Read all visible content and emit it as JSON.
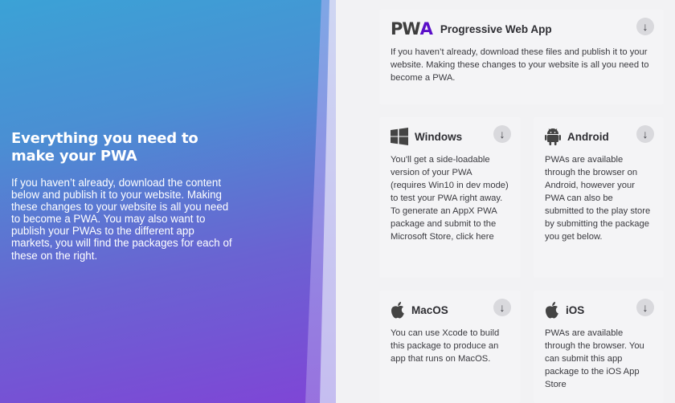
{
  "left": {
    "heading": "Everything you need to make your PWA",
    "description": "If you haven’t already, download the content below and publish it to your website. Making these changes to your website is all you need to become a PWA. You may also want to publish your PWAs to the different app markets, you will find the packages for each of these on the right."
  },
  "cards": {
    "pwa": {
      "logo": "PWA",
      "title": "Progressive Web App",
      "body": "If you haven’t already, download these files and publish it to your website. Making these changes to your website is all you need to become a PWA.",
      "icon": "pwa-logo"
    },
    "windows": {
      "title": "Windows",
      "body": "You'll get a side-loadable version of your PWA (requires Win10 in dev mode) to test your PWA right away. To generate an AppX PWA package and submit to the Microsoft Store, click here",
      "icon": "windows-icon"
    },
    "android": {
      "title": "Android",
      "body": "PWAs are available through the browser on Android, however your PWA can also be submitted to the play store by submitting the package you get below.",
      "icon": "android-icon"
    },
    "macos": {
      "title": "MacOS",
      "body": "You can use Xcode to build this package to produce an app that runs on MacOS.",
      "icon": "apple-icon"
    },
    "ios": {
      "title": "iOS",
      "body": "PWAs are available through the browser. You can submit this app package to the iOS App Store",
      "icon": "apple-icon"
    }
  },
  "download_glyph": "↓",
  "colors": {
    "gradient_top": "#3ba2d6",
    "gradient_bottom": "#7f45d6",
    "pwa_accent": "#5a0fc8",
    "card_bg": "#f4f4f6"
  }
}
